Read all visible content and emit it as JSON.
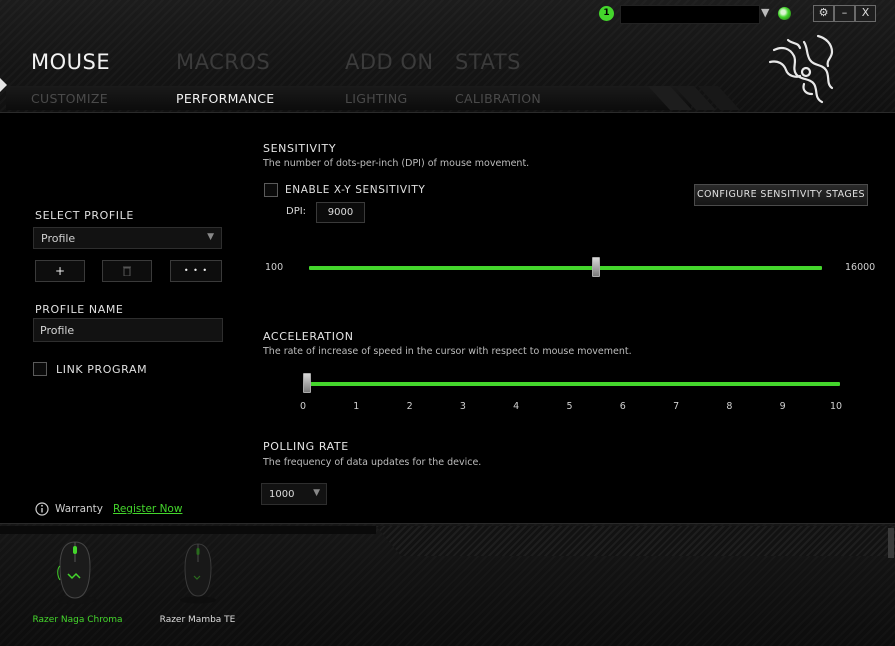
{
  "window": {
    "user_badge": "1",
    "settings_icon": "gear-icon",
    "minimize_label": "–",
    "close_label": "X"
  },
  "main_tabs": [
    {
      "label": "MOUSE",
      "active": true
    },
    {
      "label": "MACROS",
      "active": false
    },
    {
      "label": "ADD ON",
      "active": false
    },
    {
      "label": "STATS",
      "active": false
    }
  ],
  "sub_tabs": [
    {
      "label": "CUSTOMIZE",
      "active": false
    },
    {
      "label": "PERFORMANCE",
      "active": true
    },
    {
      "label": "LIGHTING",
      "active": false
    },
    {
      "label": "CALIBRATION",
      "active": false
    }
  ],
  "left_panel": {
    "select_profile_label": "SELECT PROFILE",
    "profile_selected": "Profile",
    "add_button": "+",
    "delete_icon": "trash-icon",
    "more_button": "• • •",
    "profile_name_label": "PROFILE NAME",
    "profile_name_value": "Profile",
    "link_program_label": "LINK PROGRAM",
    "link_program_checked": false,
    "warranty_label": "Warranty",
    "register_label": "Register Now"
  },
  "sensitivity": {
    "title": "SENSITIVITY",
    "description": "The number of dots-per-inch (DPI) of mouse movement.",
    "enable_xy_label": "ENABLE X-Y SENSITIVITY",
    "enable_xy_checked": false,
    "dpi_label": "DPI:",
    "dpi_value": "9000",
    "configure_button": "CONFIGURE SENSITIVITY STAGES",
    "min_label": "100",
    "max_label": "16000",
    "min": 100,
    "max": 16000,
    "value": 9000
  },
  "acceleration": {
    "title": "ACCELERATION",
    "description": "The rate of increase of speed in the cursor with respect to mouse movement.",
    "ticks": [
      "0",
      "1",
      "2",
      "3",
      "4",
      "5",
      "6",
      "7",
      "8",
      "9",
      "10"
    ],
    "value": 0
  },
  "polling": {
    "title": "POLLING RATE",
    "description": "The frequency of data updates for the device.",
    "value": "1000"
  },
  "devices": [
    {
      "name": "Razer Naga Chroma",
      "active": true
    },
    {
      "name": "Razer Mamba TE",
      "active": false
    }
  ],
  "colors": {
    "accent": "#44d62c",
    "background": "#000000"
  }
}
